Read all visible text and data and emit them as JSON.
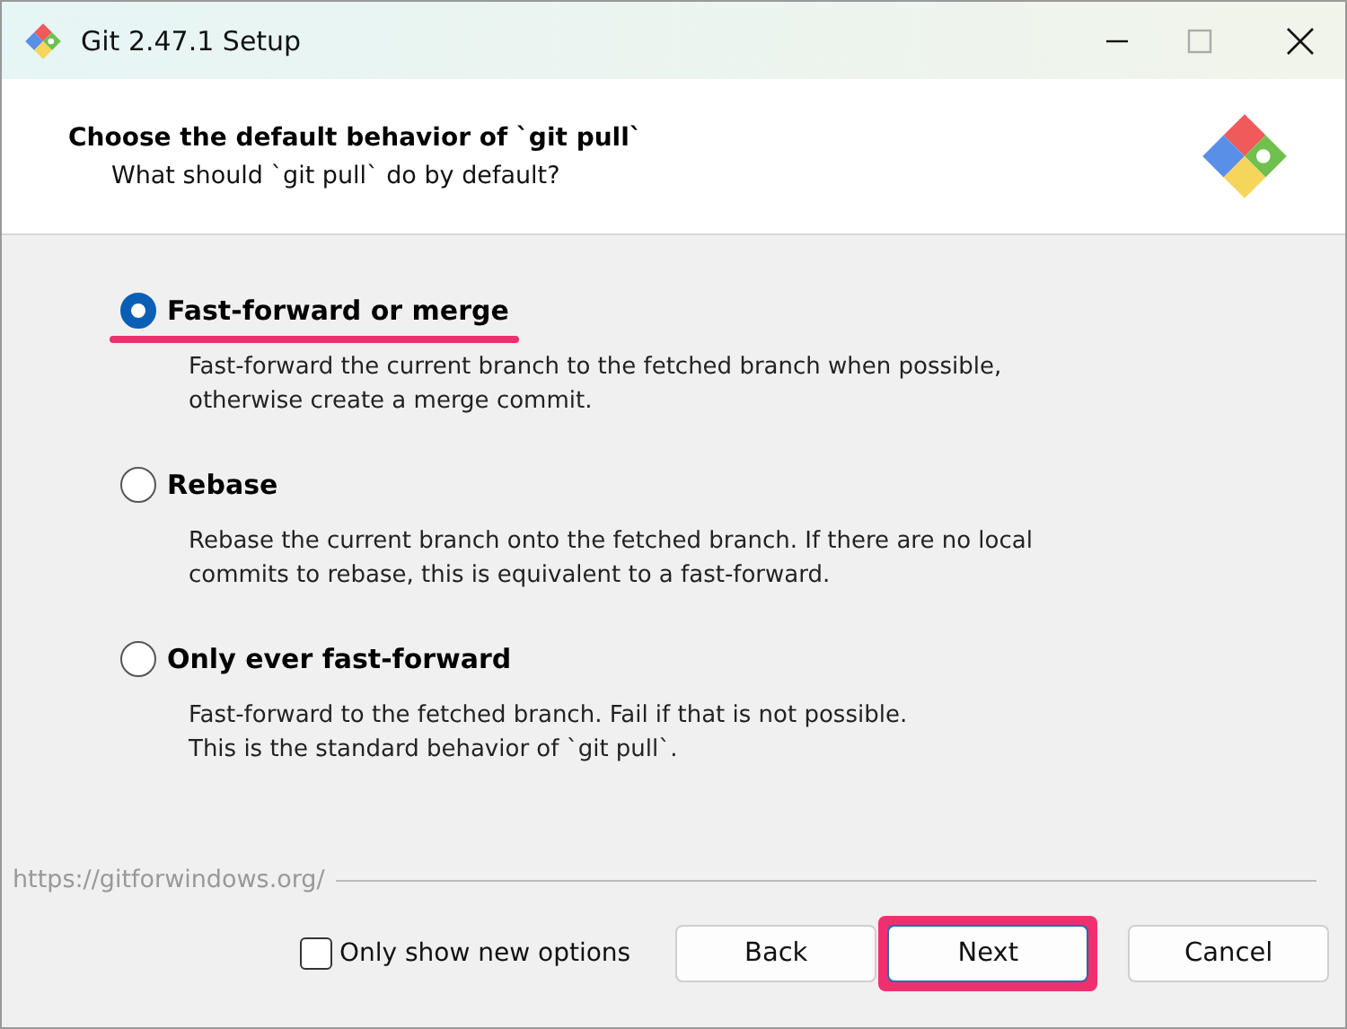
{
  "window": {
    "title": "Git 2.47.1 Setup"
  },
  "header": {
    "title": "Choose the default behavior of `git pull`",
    "subtitle": "What should `git pull` do by default?"
  },
  "options": [
    {
      "label": "Fast-forward or merge",
      "selected": true,
      "highlighted": true,
      "description_lines": [
        "Fast-forward the current branch to the fetched branch when possible,",
        "otherwise create a merge commit."
      ]
    },
    {
      "label": "Rebase",
      "selected": false,
      "highlighted": false,
      "description_lines": [
        "Rebase the current branch onto the fetched branch. If there are no local",
        "commits to rebase, this is equivalent to a fast-forward."
      ]
    },
    {
      "label": "Only ever fast-forward",
      "selected": false,
      "highlighted": false,
      "description_lines": [
        "Fast-forward to the fetched branch. Fail if that is not possible.",
        "This is the standard behavior of `git pull`."
      ]
    }
  ],
  "footer": {
    "url": "https://gitforwindows.org/",
    "only_new_options": {
      "label": "Only show new options",
      "checked": false
    },
    "buttons": [
      {
        "label": "Back",
        "default": false,
        "highlighted": false
      },
      {
        "label": "Next",
        "default": true,
        "highlighted": true
      },
      {
        "label": "Cancel",
        "default": false,
        "highlighted": false
      }
    ]
  }
}
